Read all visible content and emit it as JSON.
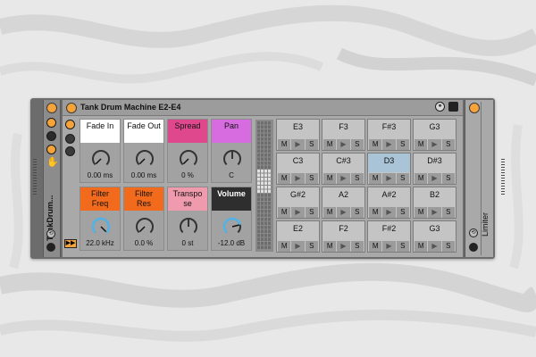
{
  "rack": {
    "name": "TankDrum...",
    "title": "Tank Drum Machine E2-E4"
  },
  "macros": [
    {
      "label": "Fade In",
      "value": "0.00 ms",
      "color": "#ffffff",
      "level": 0.0
    },
    {
      "label": "Fade Out",
      "value": "0.00 ms",
      "color": "#ffffff",
      "level": 0.0
    },
    {
      "label": "Spread",
      "value": "0 %",
      "color": "#e0488e",
      "level": 0.0
    },
    {
      "label": "Pan",
      "value": "C",
      "color": "#d66ce0",
      "level": 0.5
    },
    {
      "label": "Filter\nFreq",
      "value": "22.0 kHz",
      "color": "#f26a1b",
      "level": 1.0
    },
    {
      "label": "Filter\nRes",
      "value": "0.0 %",
      "color": "#f26a1b",
      "level": 0.0
    },
    {
      "label": "Transpo\nse",
      "value": "0 st",
      "color": "#f09aad",
      "level": 0.5
    },
    {
      "label": "Volume",
      "value": "-12.0 dB",
      "color": "#2e2e2e",
      "level": 0.78
    }
  ],
  "pad_controls": {
    "mute": "M",
    "play": "▶",
    "solo": "S"
  },
  "pads": [
    {
      "note": "E3",
      "selected": false
    },
    {
      "note": "F3",
      "selected": false
    },
    {
      "note": "F#3",
      "selected": false
    },
    {
      "note": "G3",
      "selected": false
    },
    {
      "note": "C3",
      "selected": false
    },
    {
      "note": "C#3",
      "selected": false
    },
    {
      "note": "D3",
      "selected": true
    },
    {
      "note": "D#3",
      "selected": false
    },
    {
      "note": "G#2",
      "selected": false
    },
    {
      "note": "A2",
      "selected": false
    },
    {
      "note": "A#2",
      "selected": false
    },
    {
      "note": "B2",
      "selected": false
    },
    {
      "note": "E2",
      "selected": false
    },
    {
      "note": "F2",
      "selected": false
    },
    {
      "note": "F#2",
      "selected": false
    },
    {
      "note": "G3",
      "selected": false
    }
  ],
  "limiter": {
    "name": "Limiter"
  },
  "colors": {
    "accent": "#f6a33a",
    "knob_arc": "#4fb4e8"
  }
}
